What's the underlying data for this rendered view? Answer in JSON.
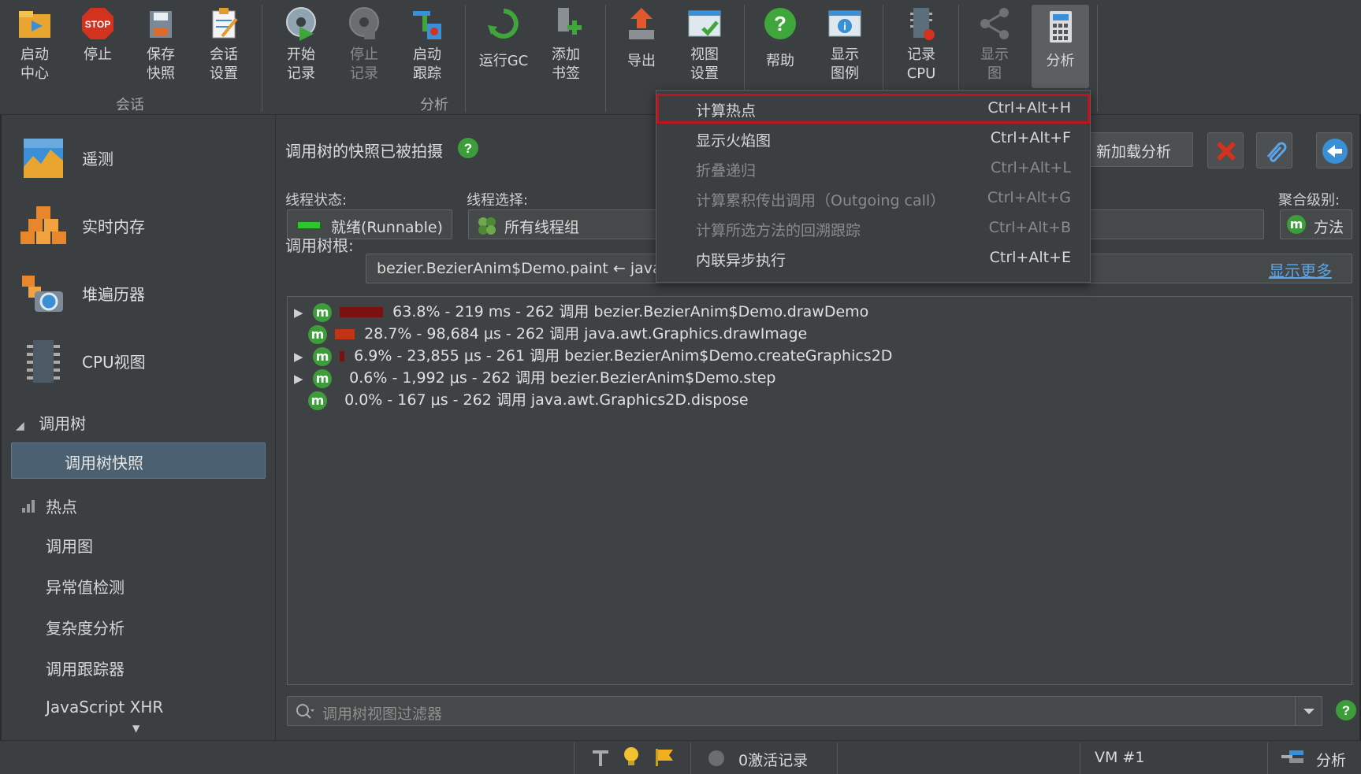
{
  "toolbar": {
    "buttons": [
      {
        "label": "启动\n中心",
        "icon": "folder-launch-icon"
      },
      {
        "label": "停止",
        "icon": "stop-sign-icon"
      },
      {
        "label": "保存\n快照",
        "icon": "save-disk-icon"
      },
      {
        "label": "会话\n设置",
        "icon": "session-settings-icon"
      },
      {
        "label": "开始\n记录",
        "icon": "start-recording-icon"
      },
      {
        "label": "停止\n记录",
        "icon": "stop-recording-icon"
      },
      {
        "label": "启动\n跟踪",
        "icon": "start-tracking-icon"
      },
      {
        "label": "运行GC",
        "icon": "run-gc-icon"
      },
      {
        "label": "添加\n书签",
        "icon": "add-bookmark-icon"
      },
      {
        "label": "导出",
        "icon": "export-icon"
      },
      {
        "label": "视图\n设置",
        "icon": "view-settings-icon"
      },
      {
        "label": "帮助",
        "icon": "help-icon"
      },
      {
        "label": "显示\n图例",
        "icon": "show-legend-icon"
      },
      {
        "label": "记录\nCPU",
        "icon": "record-cpu-icon"
      },
      {
        "label": "显示\n图",
        "icon": "show-graph-icon"
      },
      {
        "label": "分析",
        "icon": "calculator-icon"
      }
    ],
    "groups": {
      "session": "会话",
      "profiling": "分析"
    }
  },
  "sidebar": {
    "big_items": [
      {
        "label": "遥测",
        "icon": "telemetry-icon"
      },
      {
        "label": "实时内存",
        "icon": "live-memory-icon"
      },
      {
        "label": "堆遍历器",
        "icon": "heap-walker-icon"
      },
      {
        "label": "CPU视图",
        "icon": "cpu-chip-icon"
      }
    ],
    "section": "调用树",
    "selected": "调用树快照",
    "items": [
      "热点",
      "调用图",
      "异常值检测",
      "复杂度分析",
      "调用跟踪器",
      "JavaScript XHR"
    ]
  },
  "main": {
    "header": "调用树的快照已被拍摄",
    "reload_button": "新加载分析",
    "thread_state_label": "线程状态:",
    "thread_state_value": "就绪(Runnable)",
    "thread_select_label": "线程选择:",
    "thread_select_value": "所有线程组",
    "aggregation_label": "聚合级别:",
    "aggregation_value": "方法",
    "root_label": "调用树根:",
    "root_value": "bezier.BezierAnim$Demo.paint ← java",
    "show_more": "显示更多",
    "rows": [
      {
        "text": "63.8% - 219 ms - 262 调用 bezier.BezierAnim$Demo.drawDemo",
        "expandable": true,
        "bar": 0.638
      },
      {
        "text": "28.7% - 98,684 μs - 262 调用 java.awt.Graphics.drawImage",
        "expandable": false,
        "bar": 0.287
      },
      {
        "text": "6.9% - 23,855 μs - 261 调用 bezier.BezierAnim$Demo.createGraphics2D",
        "expandable": true,
        "bar": 0.069
      },
      {
        "text": "0.6% - 1,992 μs - 262 调用 bezier.BezierAnim$Demo.step",
        "expandable": true,
        "bar": 0.006
      },
      {
        "text": "0.0% - 167 μs - 262 调用 java.awt.Graphics2D.dispose",
        "expandable": false,
        "bar": 0.0
      }
    ],
    "filter_placeholder": "调用树视图过滤器"
  },
  "menu": {
    "items": [
      {
        "label": "计算热点",
        "shortcut": "Ctrl+Alt+H",
        "enabled": true,
        "highlighted": true
      },
      {
        "label": "显示火焰图",
        "shortcut": "Ctrl+Alt+F",
        "enabled": true
      },
      {
        "label": "折叠递归",
        "shortcut": "Ctrl+Alt+L",
        "enabled": false
      },
      {
        "label": "计算累积传出调用（Outgoing call）",
        "shortcut": "Ctrl+Alt+G",
        "enabled": false
      },
      {
        "label": "计算所选方法的回溯跟踪",
        "shortcut": "Ctrl+Alt+B",
        "enabled": false
      },
      {
        "label": "内联异步执行",
        "shortcut": "Ctrl+Alt+E",
        "enabled": true
      }
    ]
  },
  "status": {
    "recordings": "0激活记录",
    "vm": "VM #1",
    "mode": "分析"
  },
  "colors": {
    "accent_red": "#c0131b",
    "green_badge": "#3e9d3b",
    "link": "#5aa5e8"
  }
}
